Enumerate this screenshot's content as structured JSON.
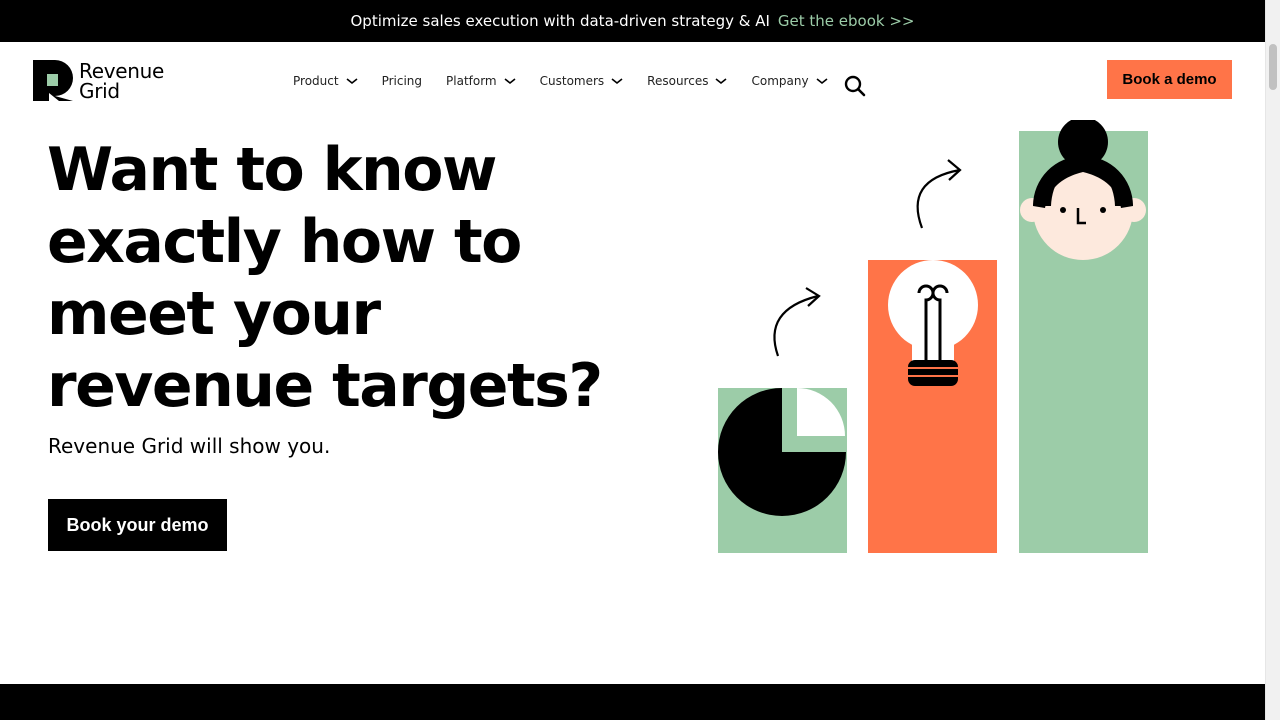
{
  "announcement": {
    "message": "Optimize sales execution with data-driven strategy & AI",
    "link": "Get the ebook >>"
  },
  "brand": {
    "line1": "Revenue",
    "line2": "Grid",
    "accent": "#9ccca8",
    "orange": "#ff7448"
  },
  "nav": {
    "items": [
      {
        "label": "Product",
        "has_dropdown": true
      },
      {
        "label": "Pricing",
        "has_dropdown": false
      },
      {
        "label": "Platform",
        "has_dropdown": true
      },
      {
        "label": "Customers",
        "has_dropdown": true
      },
      {
        "label": "Resources",
        "has_dropdown": true
      },
      {
        "label": "Company",
        "has_dropdown": true
      }
    ],
    "search_icon": "search-icon",
    "cta_label": "Book a demo"
  },
  "hero": {
    "title": "Want to know exactly how to meet your revenue targets?",
    "subtitle": "Revenue Grid will show you.",
    "cta_label": "Book your demo"
  }
}
